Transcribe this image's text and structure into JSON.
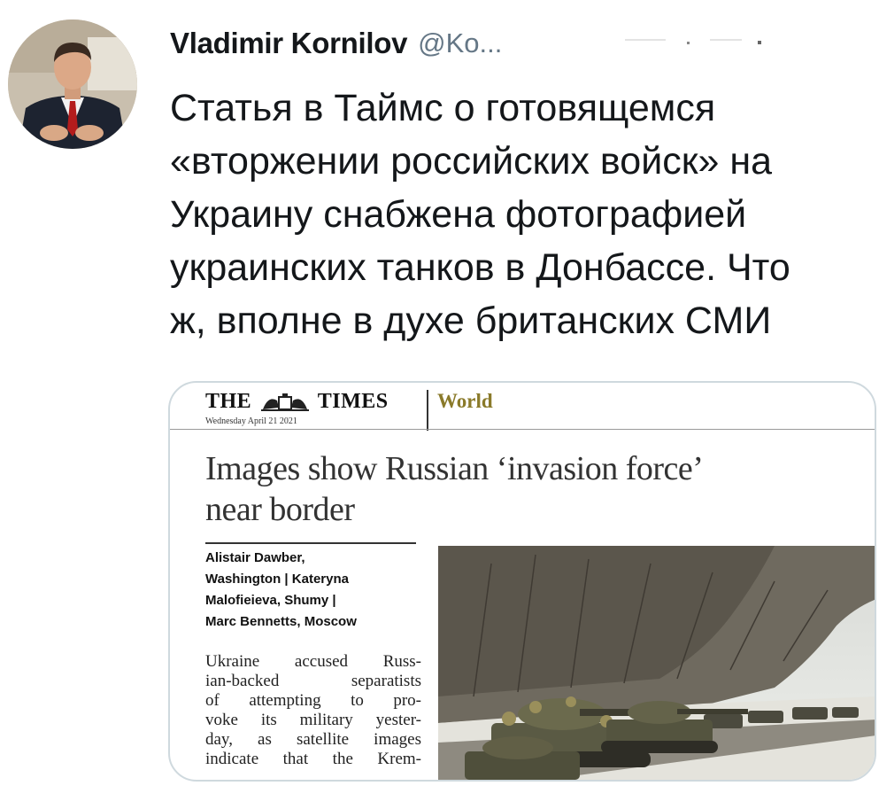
{
  "tweet": {
    "author_name": "Vladimir Kornilov",
    "author_handle": "@Ko...",
    "text_lines": [
      "Статья в Таймс о готовящемся",
      "«вторжении российских войск» на",
      "Украину снабжена фотографией",
      "украинских танков в Донбассе. Что",
      "ж, вполне в духе британских СМИ"
    ]
  },
  "card": {
    "masthead_left": "THE",
    "masthead_right": "TIMES",
    "dateline": "Wednesday April 21 2021",
    "section": "World",
    "headline_lines": [
      "Images show Russian ‘invasion force’",
      "near border"
    ],
    "byline_lines": [
      "Alistair Dawber,",
      "Washington | Kateryna",
      "Malofieieva, Shumy |",
      "Marc Bennetts, Moscow"
    ],
    "body_lines": [
      "Ukraine accused Russ-",
      "ian-backed separatists",
      "of attempting to pro-",
      "voke its military yester-",
      "day, as satellite images",
      "indicate that the Krem-"
    ]
  },
  "icons": {
    "avatar": "person-in-suit-avatar",
    "crest": "royal-crest-icon",
    "photo": "tanks-on-road-photo"
  },
  "colors": {
    "text": "#14171a",
    "handle": "#657786",
    "card_border": "#cfd9de",
    "section": "#8a7a2a"
  }
}
